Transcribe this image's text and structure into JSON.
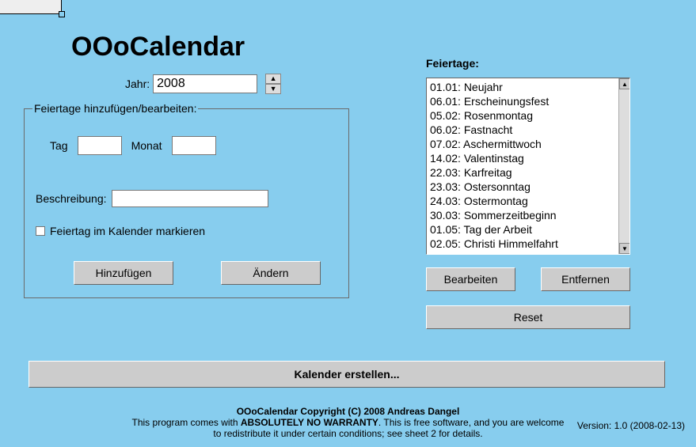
{
  "title": "OOoCalendar",
  "year": {
    "label": "Jahr:",
    "value": "2008"
  },
  "fieldset": {
    "legend": "Feiertage hinzufügen/bearbeiten:",
    "day_label": "Tag",
    "month_label": "Monat",
    "day_value": "",
    "month_value": "",
    "desc_label": "Beschreibung:",
    "desc_value": "",
    "check_label": "Feiertag im Kalender markieren",
    "add_button": "Hinzufügen",
    "change_button": "Ändern"
  },
  "holidays": {
    "label": "Feiertage:",
    "items": [
      "01.01: Neujahr",
      "06.01: Erscheinungsfest",
      "05.02: Rosenmontag",
      "06.02: Fastnacht",
      "07.02: Aschermittwoch",
      "14.02: Valentinstag",
      "22.03: Karfreitag",
      "23.03: Ostersonntag",
      "24.03: Ostermontag",
      "30.03: Sommerzeitbeginn",
      "01.05: Tag der Arbeit",
      "02.05: Christi Himmelfahrt"
    ],
    "edit_button": "Bearbeiten",
    "remove_button": "Entfernen",
    "reset_button": "Reset"
  },
  "create_button": "Kalender erstellen...",
  "footer": {
    "line1a": "OOoCalendar  Copyright (C) 2008  Andreas Dangel",
    "line2a": "This program comes with ",
    "line2b": "ABSOLUTELY NO WARRANTY",
    "line2c": ". This is free software, and you are welcome",
    "line3": "to redistribute it under certain conditions; see sheet 2 for details."
  },
  "version": {
    "label": "Version: 1.",
    "rest": "0 (2008-02-13)"
  }
}
